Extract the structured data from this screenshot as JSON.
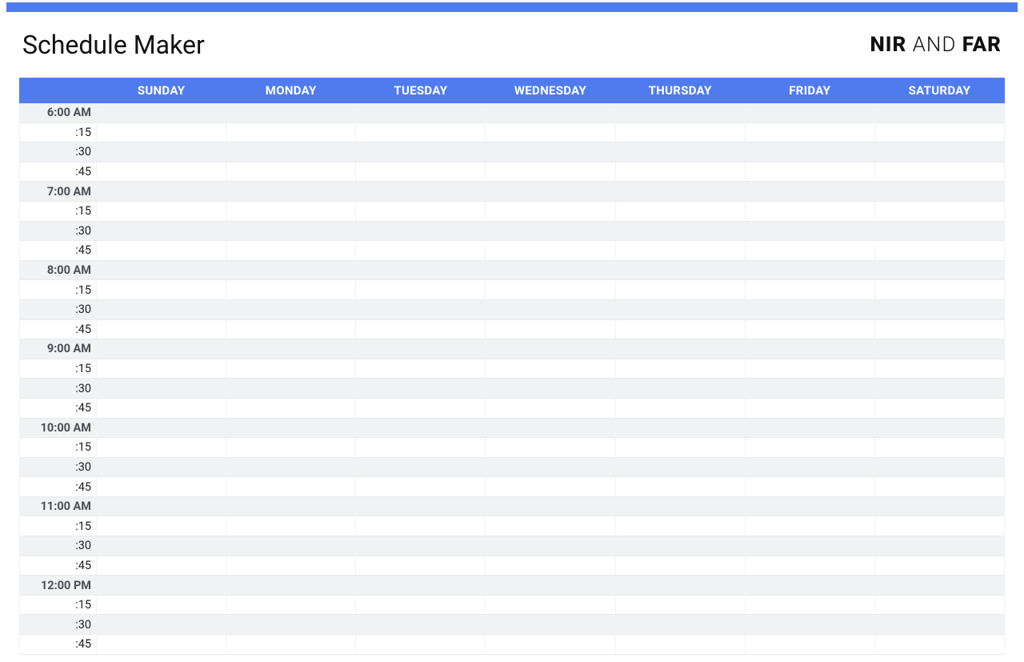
{
  "header": {
    "title": "Schedule Maker",
    "brand_bold1": "NIR",
    "brand_mid": " AND ",
    "brand_bold2": "FAR"
  },
  "days": [
    "SUNDAY",
    "MONDAY",
    "TUESDAY",
    "WEDNESDAY",
    "THURSDAY",
    "FRIDAY",
    "SATURDAY"
  ],
  "time_slots": [
    {
      "label": "6:00 AM",
      "hour": true
    },
    {
      "label": ":15",
      "hour": false
    },
    {
      "label": ":30",
      "hour": false
    },
    {
      "label": ":45",
      "hour": false
    },
    {
      "label": "7:00 AM",
      "hour": true
    },
    {
      "label": ":15",
      "hour": false
    },
    {
      "label": ":30",
      "hour": false
    },
    {
      "label": ":45",
      "hour": false
    },
    {
      "label": "8:00 AM",
      "hour": true
    },
    {
      "label": ":15",
      "hour": false
    },
    {
      "label": ":30",
      "hour": false
    },
    {
      "label": ":45",
      "hour": false
    },
    {
      "label": "9:00 AM",
      "hour": true
    },
    {
      "label": ":15",
      "hour": false
    },
    {
      "label": ":30",
      "hour": false
    },
    {
      "label": ":45",
      "hour": false
    },
    {
      "label": "10:00 AM",
      "hour": true
    },
    {
      "label": ":15",
      "hour": false
    },
    {
      "label": ":30",
      "hour": false
    },
    {
      "label": ":45",
      "hour": false
    },
    {
      "label": "11:00 AM",
      "hour": true
    },
    {
      "label": ":15",
      "hour": false
    },
    {
      "label": ":30",
      "hour": false
    },
    {
      "label": ":45",
      "hour": false
    },
    {
      "label": "12:00 PM",
      "hour": true
    },
    {
      "label": ":15",
      "hour": false
    },
    {
      "label": ":30",
      "hour": false
    },
    {
      "label": ":45",
      "hour": false
    }
  ]
}
